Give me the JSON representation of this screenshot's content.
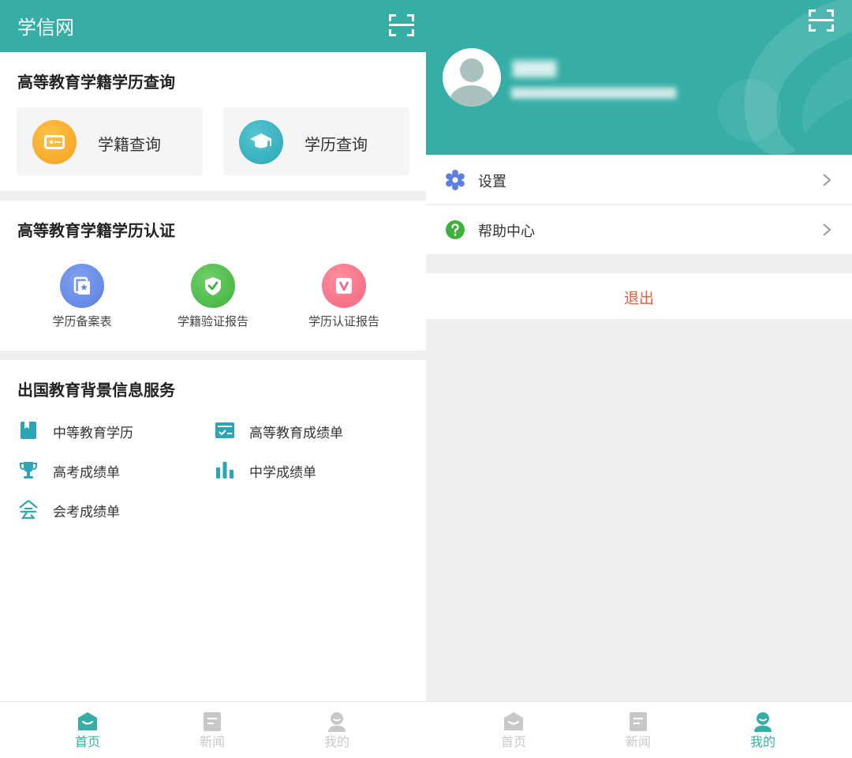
{
  "home": {
    "app_title": "学信网",
    "sections": {
      "query": {
        "title": "高等教育学籍学历查询",
        "cards": [
          {
            "label": "学籍查询",
            "icon": "id-card-icon",
            "color": "#f6a01a"
          },
          {
            "label": "学历查询",
            "icon": "graduation-cap-icon",
            "color": "#2aa6b4"
          }
        ]
      },
      "certification": {
        "title": "高等教育学籍学历认证",
        "items": [
          {
            "label": "学历备案表",
            "icon": "document-record-icon",
            "color": "#5b7fe3"
          },
          {
            "label": "学籍验证报告",
            "icon": "shield-check-icon",
            "color": "#3fb03b"
          },
          {
            "label": "学历认证报告",
            "icon": "v-badge-icon",
            "color": "#f2657c"
          }
        ]
      },
      "overseas": {
        "title": "出国教育背景信息服务",
        "items": [
          {
            "label": "中等教育学历",
            "icon": "book-icon"
          },
          {
            "label": "高等教育成绩单",
            "icon": "transcript-icon"
          },
          {
            "label": "高考成绩单",
            "icon": "trophy-icon"
          },
          {
            "label": "中学成绩单",
            "icon": "bar-chart-icon"
          },
          {
            "label": "会考成绩单",
            "icon": "hui-character-icon"
          }
        ]
      }
    }
  },
  "profile": {
    "menu": [
      {
        "label": "设置",
        "icon": "gear-icon",
        "color": "#5b7fe3"
      },
      {
        "label": "帮助中心",
        "icon": "question-circle-icon",
        "color": "#3fb03b"
      }
    ],
    "logout_label": "退出"
  },
  "nav": {
    "home": "首页",
    "news": "新闻",
    "mine": "我的"
  },
  "colors": {
    "brand": "#36aea6",
    "logout": "#e65a3e",
    "inactive": "#c8c8c8"
  }
}
